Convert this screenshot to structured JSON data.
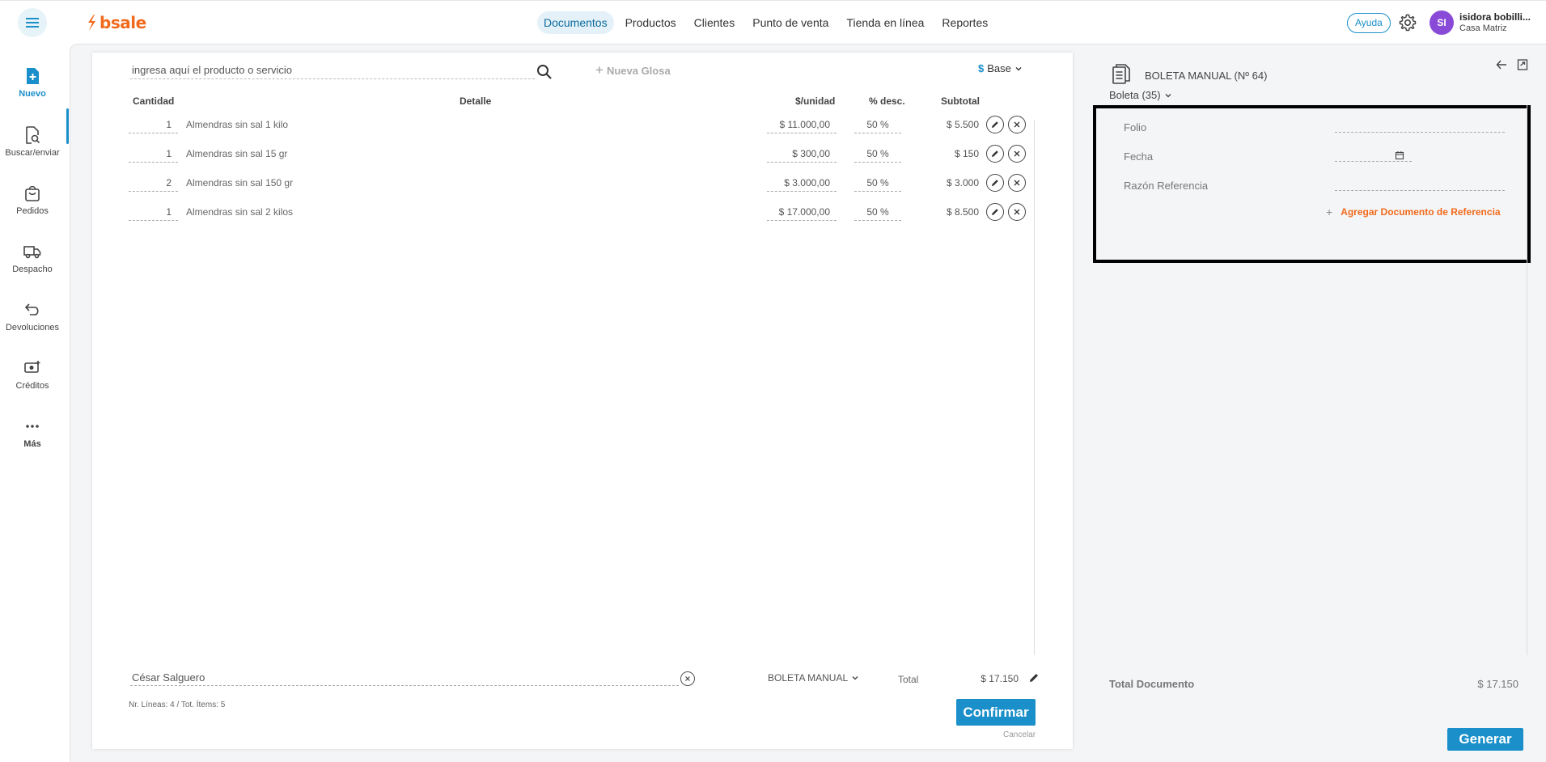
{
  "app": {
    "logo_text": "bsale",
    "brand_color": "#f26a1b",
    "accent_color": "#1a8fc9"
  },
  "nav": {
    "items": [
      {
        "label": "Documentos",
        "active": true
      },
      {
        "label": "Productos"
      },
      {
        "label": "Clientes"
      },
      {
        "label": "Punto de venta"
      },
      {
        "label": "Tienda en línea"
      },
      {
        "label": "Reportes"
      }
    ]
  },
  "header": {
    "help_label": "Ayuda",
    "avatar_initials": "SI",
    "user_name": "isidora bobilli...",
    "branch": "Casa Matriz"
  },
  "sidebar": {
    "items": [
      {
        "label": "Nuevo",
        "icon": "new-document-icon",
        "active": true
      },
      {
        "label": "Buscar/enviar",
        "icon": "search-document-icon"
      },
      {
        "label": "Pedidos",
        "icon": "shopping-bag-icon"
      },
      {
        "label": "Despacho",
        "icon": "truck-icon"
      },
      {
        "label": "Devoluciones",
        "icon": "return-arrow-icon"
      },
      {
        "label": "Créditos",
        "icon": "money-add-icon"
      },
      {
        "label": "Más",
        "icon": "more-dots-icon"
      }
    ]
  },
  "document": {
    "search_placeholder": "ingresa aquí el producto o servicio",
    "nueva_glosa": "Nueva Glosa",
    "price_list_symbol": "$",
    "price_list": "Base",
    "columns": {
      "qty": "Cantidad",
      "detail": "Detalle",
      "unit_price": "$/unidad",
      "discount": "% desc.",
      "subtotal": "Subtotal"
    },
    "rows": [
      {
        "qty": "1",
        "detail": "Almendras sin sal 1 kilo",
        "unit_price": "$ 11.000,00",
        "discount": "50 %",
        "subtotal": "$ 5.500"
      },
      {
        "qty": "1",
        "detail": "Almendras sin sal 15 gr",
        "unit_price": "$ 300,00",
        "discount": "50 %",
        "subtotal": "$ 150"
      },
      {
        "qty": "2",
        "detail": "Almendras sin sal 150 gr",
        "unit_price": "$ 3.000,00",
        "discount": "50 %",
        "subtotal": "$ 3.000"
      },
      {
        "qty": "1",
        "detail": "Almendras sin sal 2 kilos",
        "unit_price": "$ 17.000,00",
        "discount": "50 %",
        "subtotal": "$ 8.500"
      }
    ],
    "client_value": "César Salguero",
    "doc_type": "BOLETA MANUAL",
    "total_label": "Total",
    "total_value": "$ 17.150",
    "lines_info": "Nr. Líneas: 4 / Tot. Ítems: 5",
    "confirm_label": "Confirmar",
    "cancel_label": "Cancelar"
  },
  "right_panel": {
    "title": "BOLETA MANUAL (Nº 64)",
    "boleta_select": "Boleta (35)",
    "reference": {
      "folio_label": "Folio",
      "fecha_label": "Fecha",
      "razon_label": "Razón Referencia",
      "add_label": "Agregar Documento de Referencia"
    },
    "total_doc_label": "Total Documento",
    "total_doc_value": "$ 17.150",
    "generate_label": "Generar"
  }
}
